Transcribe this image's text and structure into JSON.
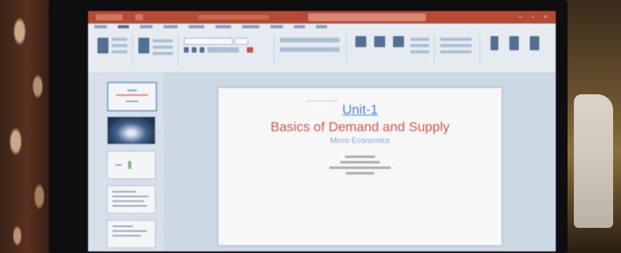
{
  "slide": {
    "title": "Unit-1",
    "subtitle": "Basics of Demand and Supply",
    "subsub": "Micro Economics"
  },
  "colors": {
    "titlebar": "#b54a35",
    "slide_title": "#4a86d0",
    "slide_subtitle": "#d9574c",
    "slide_subsub": "#7ea6d6"
  },
  "icons": [
    "window-minimize-icon",
    "window-maximize-icon",
    "window-close-icon"
  ]
}
